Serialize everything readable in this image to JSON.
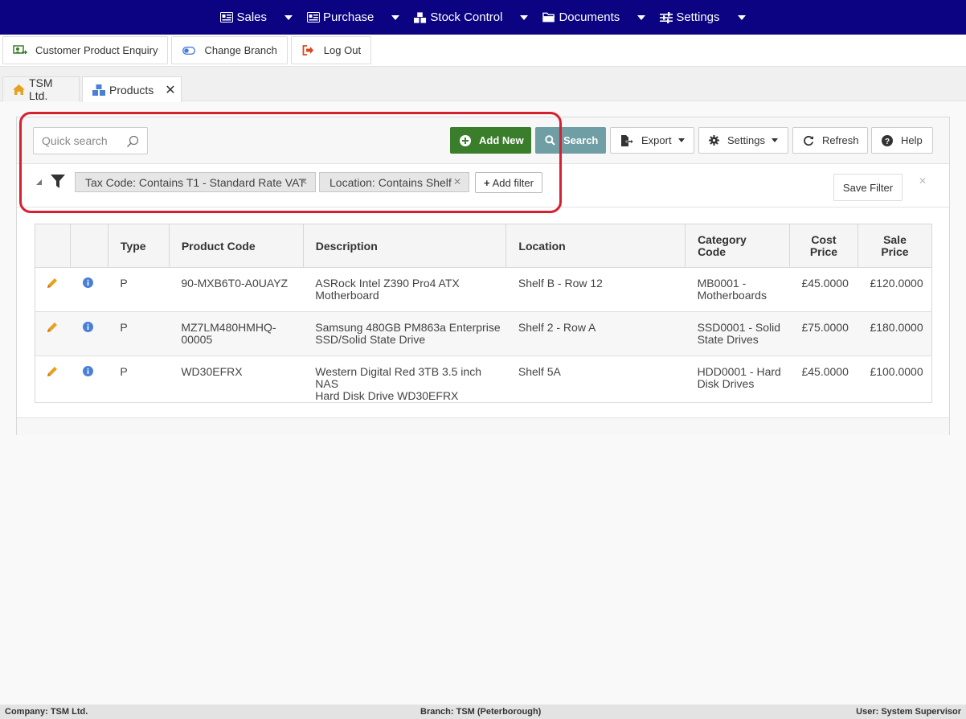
{
  "nav": {
    "items": [
      {
        "label": "Sales",
        "icon": "sales-card-icon"
      },
      {
        "label": "Purchase",
        "icon": "purchase-card-icon"
      },
      {
        "label": "Stock Control",
        "icon": "stock-boxes-icon"
      },
      {
        "label": "Documents",
        "icon": "folder-icon"
      },
      {
        "label": "Settings",
        "icon": "sliders-icon"
      }
    ]
  },
  "toolbar": {
    "customer_enquiry": "Customer Product Enquiry",
    "change_branch": "Change Branch",
    "log_out": "Log Out"
  },
  "tabs": [
    {
      "label": "TSM Ltd."
    },
    {
      "label": "Products",
      "close": "✕"
    }
  ],
  "search": {
    "placeholder": "Quick search",
    "add_new": "Add New",
    "search": "Search",
    "export": "Export",
    "settings": "Settings",
    "refresh": "Refresh",
    "help": "Help"
  },
  "filters": {
    "chips": [
      {
        "label": "Tax Code: Contains T1 - Standard Rate VAT"
      },
      {
        "label": "Location: Contains Shelf"
      }
    ],
    "add_filter": "Add filter",
    "save_filter": "Save Filter"
  },
  "grid": {
    "columns": [
      "Type",
      "Product Code",
      "Description",
      "Location",
      "Category Code",
      "Cost Price",
      "Sale Price"
    ],
    "col_lines": {
      "category": [
        "Category",
        "Code"
      ],
      "cost": [
        "Cost",
        "Price"
      ],
      "sale": [
        "Sale",
        "Price"
      ]
    },
    "rows": [
      {
        "type": "P",
        "code_lines": [
          "90-MXB6T0-A0UAYZ",
          ""
        ],
        "desc_lines": [
          "ASRock Intel Z390 Pro4 ATX",
          "Motherboard"
        ],
        "location": "Shelf B - Row 12",
        "cat_lines": [
          "MB0001 -",
          "Motherboards"
        ],
        "cost": "£45.0000",
        "sale": "£120.0000"
      },
      {
        "type": "P",
        "code_lines": [
          "MZ7LM480HMHQ-",
          "00005"
        ],
        "desc_lines": [
          "Samsung 480GB PM863a Enterprise",
          "SSD/Solid State Drive"
        ],
        "location": "Shelf 2 - Row A",
        "cat_lines": [
          "SSD0001 - Solid",
          "State Drives"
        ],
        "cost": "£75.0000",
        "sale": "£180.0000"
      },
      {
        "type": "P",
        "code_lines": [
          "WD30EFRX",
          ""
        ],
        "desc_lines": [
          "Western Digital Red 3TB 3.5 inch NAS",
          "Hard Disk Drive WD30EFRX"
        ],
        "location": "Shelf 5A",
        "cat_lines": [
          "HDD0001 - Hard",
          "Disk Drives"
        ],
        "cost": "£45.0000",
        "sale": "£100.0000"
      }
    ]
  },
  "status": {
    "company": "Company: TSM Ltd.",
    "branch": "Branch: TSM (Peterborough)",
    "user": "User: System Supervisor"
  },
  "colors": {
    "nav_bg": "#0b0382",
    "add_new_bg": "#3a7d2a",
    "search_bg": "#6f9ea4",
    "highlight": "#d62030",
    "edit_icon": "#e8a020",
    "info_icon": "#4a7fd8"
  }
}
